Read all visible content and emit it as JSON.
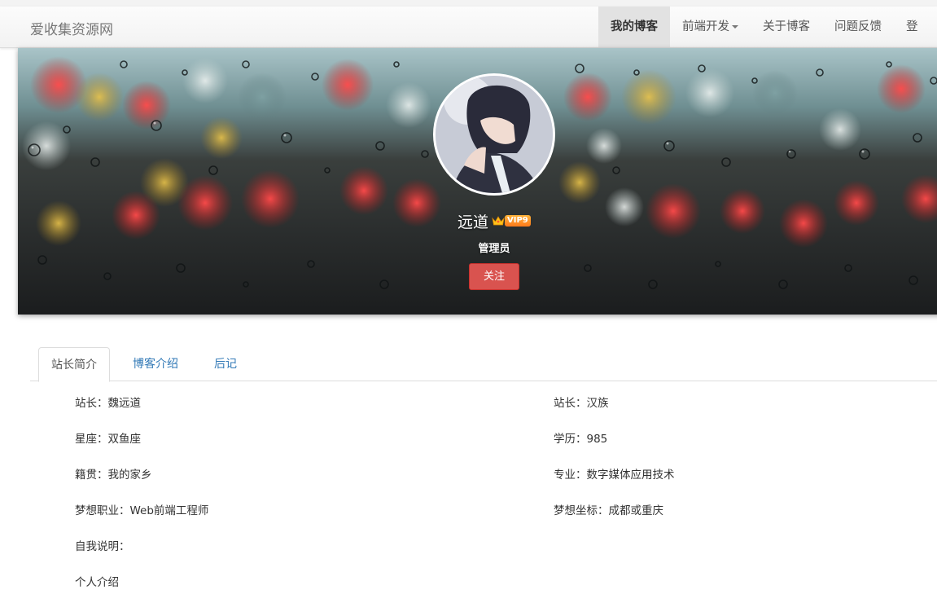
{
  "navbar": {
    "brand": "爱收集资源网",
    "items": [
      {
        "label": "我的博客",
        "active": true
      },
      {
        "label": "前端开发",
        "dropdown": true
      },
      {
        "label": "关于博客"
      },
      {
        "label": "问题反馈"
      },
      {
        "label": "登"
      }
    ]
  },
  "profile": {
    "username": "远道",
    "vip": "VIP9",
    "role": "管理员",
    "follow_label": "关注"
  },
  "tabs": [
    {
      "label": "站长简介",
      "active": true
    },
    {
      "label": "博客介绍"
    },
    {
      "label": "后记"
    }
  ],
  "intro": {
    "left": [
      "站长：魏远道",
      "星座：双鱼座",
      "籍贯：我的家乡",
      "梦想职业：Web前端工程师",
      "自我说明：",
      "个人介绍"
    ],
    "right": [
      "站长：汉族",
      "学历：985",
      "专业：数字媒体应用技术",
      "梦想坐标：成都或重庆"
    ]
  },
  "colors": {
    "follow_button": "#d9534f",
    "link": "#337ab7",
    "vip": "#ff7a1a"
  }
}
